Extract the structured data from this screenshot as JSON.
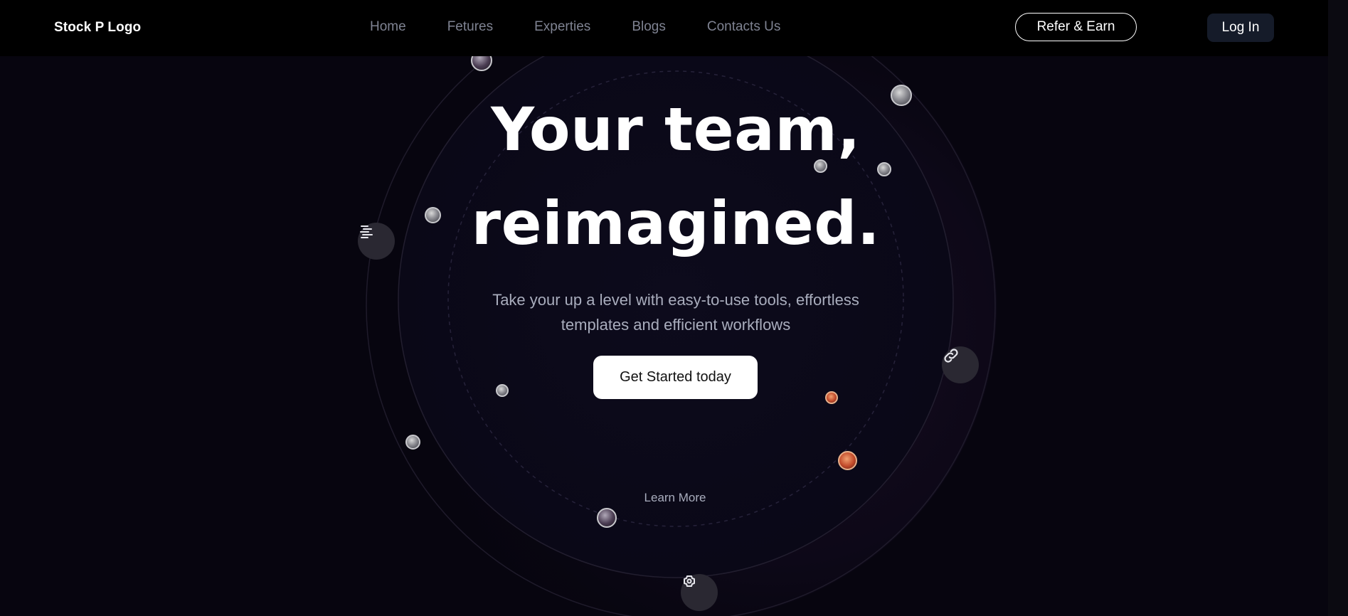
{
  "nav": {
    "logo": "Stock P Logo",
    "links": [
      "Home",
      "Fetures",
      "Experties",
      "Blogs",
      "Contacts Us"
    ],
    "refer_label": "Refer & Earn",
    "login_label": "Log In"
  },
  "hero": {
    "title_line1": "Your team,",
    "title_line2": "reimagined.",
    "subtitle_line1": "Take your up a level with easy-to-use tools, effortless",
    "subtitle_line2": "templates and efficient workflows",
    "cta_label": "Get Started today",
    "learn_more": "Learn More"
  },
  "icons": {
    "tool_left": "list-icon",
    "tool_right": "link-icon",
    "tool_bottom": "gear-icon",
    "learn_more_arrow": "arrow-down-icon"
  },
  "colors": {
    "background": "#07050f",
    "navbar": "#000000",
    "nav_link": "#7f8392",
    "subtitle": "#a9adbd",
    "login_button": "#151b29",
    "cta_button": "#ffffff"
  }
}
